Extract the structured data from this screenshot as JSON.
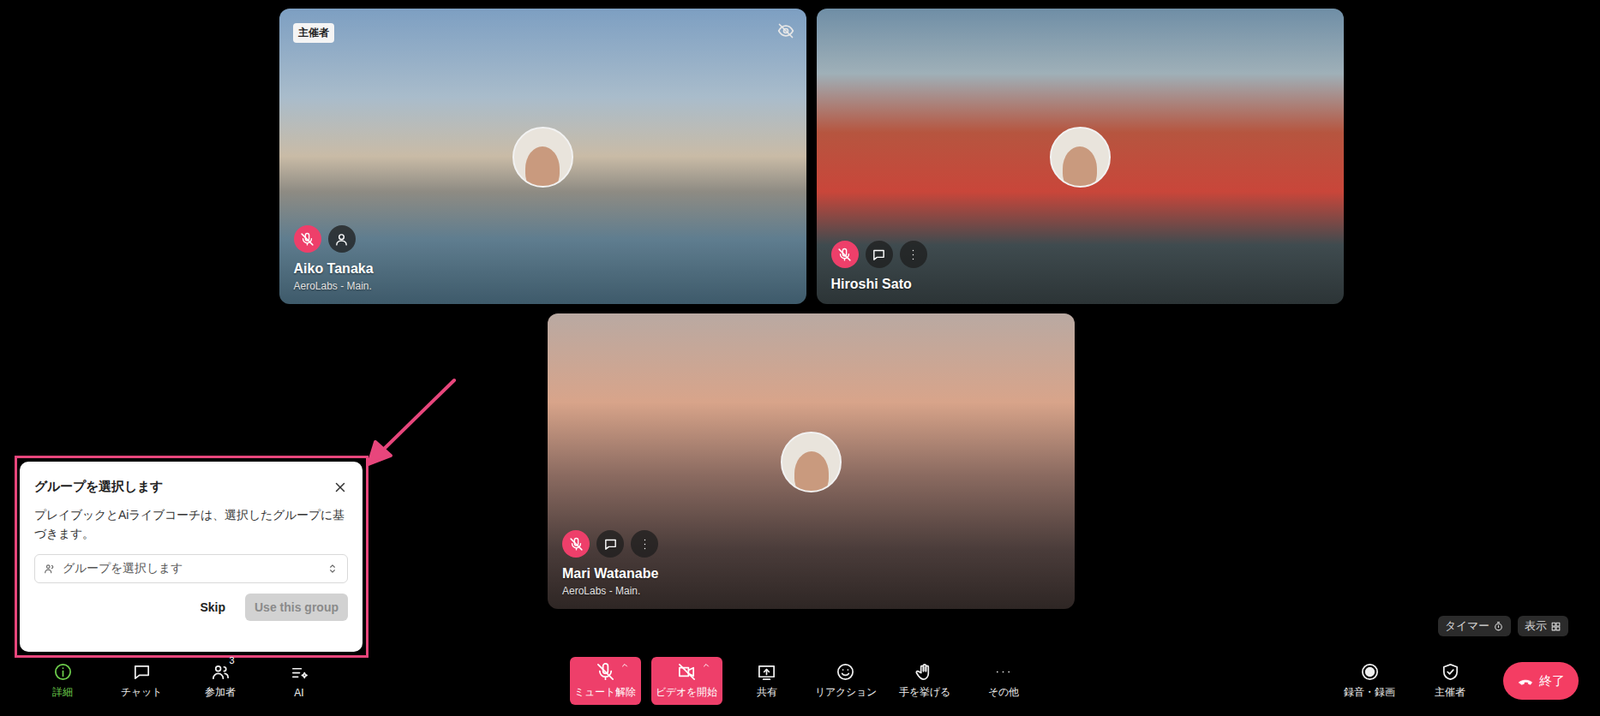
{
  "tiles": [
    {
      "name": "Aiko Tanaka",
      "subtitle": "AeroLabs - Main.",
      "badge": "主催者",
      "mic_muted": true,
      "video_hidden": true,
      "kind": "self"
    },
    {
      "name": "Hiroshi Sato",
      "mic_muted": true,
      "video_hidden": false,
      "kind": "remote"
    },
    {
      "name": "Mari Watanabe",
      "subtitle": "AeroLabs - Main.",
      "mic_muted": true,
      "video_hidden": false,
      "kind": "remote"
    }
  ],
  "popup": {
    "title": "グループを選択します",
    "body": "プレイブックとAiライブコーチは、選択したグループに基づきます。",
    "select_placeholder": "グループを選択します",
    "highlighted": true,
    "buttons": [
      {
        "label": "Skip",
        "disabled": false,
        "kind": "text"
      },
      {
        "label": "Use this group",
        "disabled": true,
        "kind": "primary"
      }
    ]
  },
  "overlay_buttons": [
    {
      "label": "タイマー"
    },
    {
      "label": "表示"
    }
  ],
  "toolbar": {
    "left": [
      {
        "label": "詳細",
        "selected": true
      },
      {
        "label": "チャット",
        "selected": false
      },
      {
        "label": "参加者",
        "selected": false,
        "badge": "3"
      },
      {
        "label": "AI",
        "selected": false
      }
    ],
    "center": [
      {
        "label": "ミュート解除",
        "kind": "alert"
      },
      {
        "label": "ビデオを開始",
        "kind": "alert"
      },
      {
        "label": "共有",
        "kind": "plain"
      },
      {
        "label": "リアクション",
        "kind": "plain"
      },
      {
        "label": "手を挙げる",
        "kind": "plain"
      },
      {
        "label": "その他",
        "kind": "plain"
      }
    ],
    "right": [
      {
        "label": "録音・録画"
      },
      {
        "label": "主催者"
      }
    ],
    "end_button": {
      "label": "終了"
    }
  }
}
